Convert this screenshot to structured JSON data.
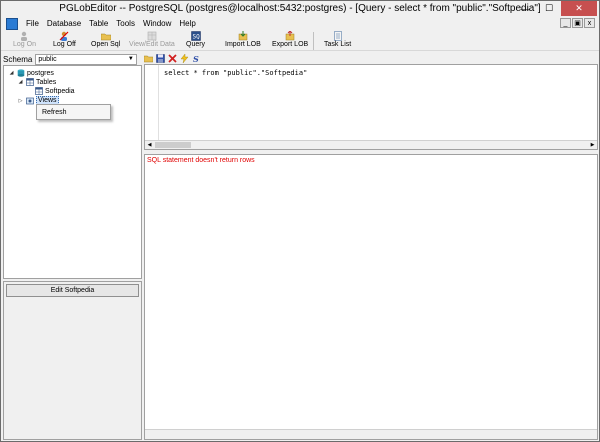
{
  "window": {
    "title": "PGLobEditor -- PostgreSQL (postgres@localhost:5432:postgres) - [Query - select * from \"public\".\"Softpedia\"]",
    "minimize_glyph": "—",
    "maximize_glyph": "☐",
    "close_glyph": "✕"
  },
  "menu": {
    "items": [
      "File",
      "Database",
      "Table",
      "Tools",
      "Window",
      "Help"
    ],
    "mdi_minimize": "_",
    "mdi_restore": "▣",
    "mdi_close": "x"
  },
  "toolbar": {
    "log_on": "Log On",
    "log_off": "Log Off",
    "open_sql": "Open Sql",
    "view_edit_data": "View/Edit Data",
    "query": "Query",
    "import_lob": "Import LOB",
    "export_lob": "Export LOB",
    "task_list": "Task List"
  },
  "schema": {
    "label": "Schema",
    "value": "public",
    "arrow": "▼"
  },
  "tree": {
    "root": "postgres",
    "tables": "Tables",
    "table_item": "Softpedia",
    "views": "Views",
    "collapse_glyph": "◢",
    "expand_glyph": "▷"
  },
  "context_menu": {
    "refresh": "Refresh"
  },
  "left_bottom": {
    "edit_button": "Edit Softpedia"
  },
  "editor": {
    "sql": "select * from \"public\".\"Softpedia\"",
    "scroll_left": "◀",
    "scroll_right": "▶"
  },
  "result": {
    "message": "SQL statement doesn't return rows"
  },
  "colors": {
    "selection": "#cfe3fc",
    "error_text": "#e00000",
    "close_button": "#c75050"
  }
}
